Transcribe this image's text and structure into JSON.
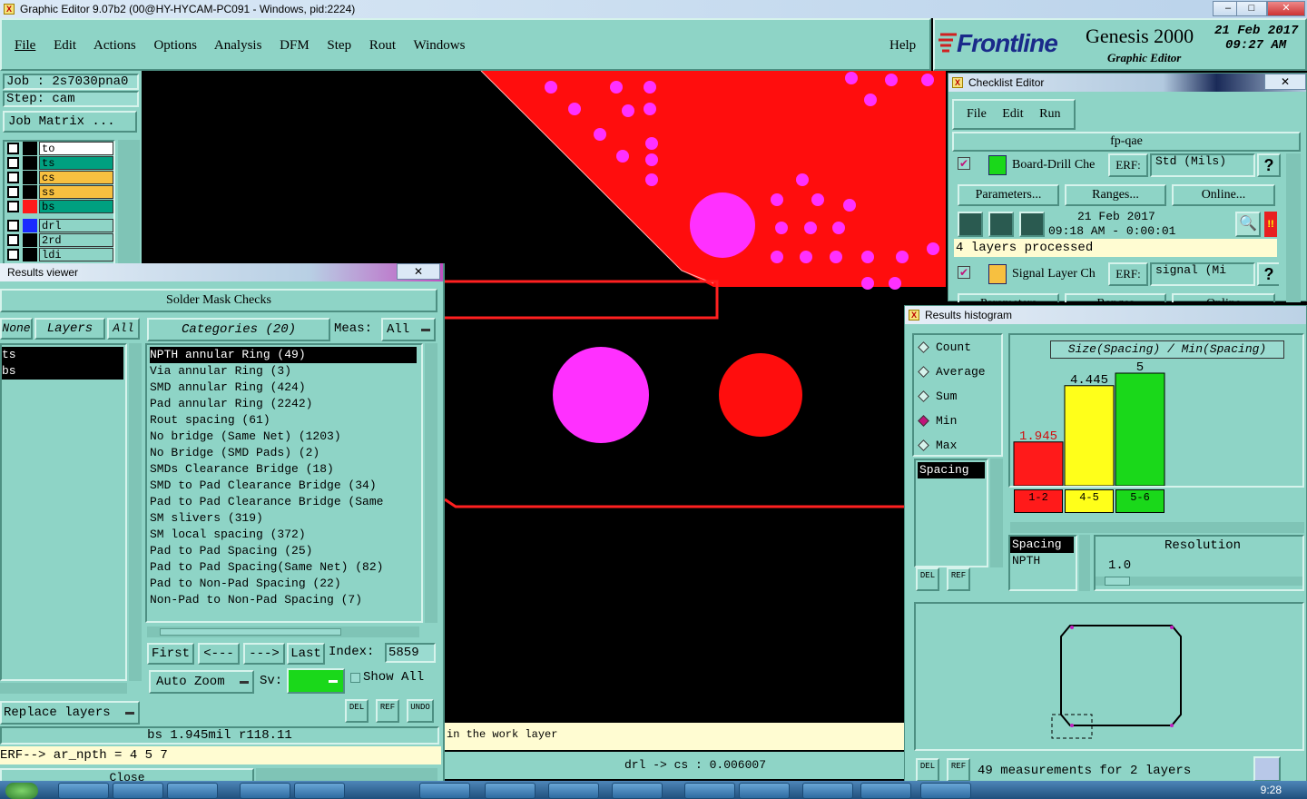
{
  "window": {
    "title": "Graphic Editor 9.07b2 (00@HY-HYCAM-PC091 - Windows, pid:2224)"
  },
  "menu": {
    "items": [
      "File",
      "Edit",
      "Actions",
      "Options",
      "Analysis",
      "DFM",
      "Step",
      "Rout",
      "Windows"
    ],
    "help": "Help"
  },
  "brand": {
    "logo": "Frontline",
    "product": "Genesis 2000",
    "subtitle": "Graphic Editor",
    "date": "21 Feb 2017",
    "time": "09:27 AM"
  },
  "job": {
    "job_line": "Job : 2s7030pna0",
    "step_line": "Step: cam",
    "matrix_button": "Job Matrix ..."
  },
  "layers": [
    {
      "name": "to",
      "color": "#ffffff"
    },
    {
      "name": "ts",
      "color": "#00a080"
    },
    {
      "name": "cs",
      "color": "#f7c040"
    },
    {
      "name": "ss",
      "color": "#f7c040"
    },
    {
      "name": "bs",
      "color": "#00a080"
    },
    {
      "name": "drl",
      "color": "#8ed4c6"
    },
    {
      "name": "2rd",
      "color": "#8ed4c6"
    },
    {
      "name": "ldi",
      "color": "#8ed4c6"
    }
  ],
  "results_viewer": {
    "title": "Results viewer",
    "heading": "Solder Mask Checks",
    "btn_none": "None",
    "btn_layers": "Layers",
    "btn_all": "All",
    "categories_label": "Categories (20)",
    "meas_label": "Meas:",
    "meas_value": "All",
    "layer_items": [
      "ts",
      "bs"
    ],
    "categories": [
      "NPTH annular Ring (49)",
      "Via annular Ring (3)",
      "SMD annular Ring (424)",
      "Pad annular Ring (2242)",
      "Rout spacing (61)",
      "No bridge (Same Net) (1203)",
      "No Bridge (SMD Pads) (2)",
      "SMDs Clearance Bridge (18)",
      "SMD to Pad Clearance Bridge (34)",
      "Pad to Pad Clearance Bridge (Same",
      "SM slivers (319)",
      "SM local spacing (372)",
      "Pad to Pad Spacing (25)",
      "Pad to Pad Spacing(Same Net) (82)",
      "Pad to Non-Pad Spacing (22)",
      "Non-Pad to Non-Pad Spacing (7)"
    ],
    "nav": {
      "first": "First",
      "prev": "<---",
      "next": "--->",
      "last": "Last",
      "index_label": "Index:",
      "index_value": "5859"
    },
    "auto_zoom": "Auto Zoom",
    "sv_label": "Sv:",
    "show_all": "Show All",
    "replace_layers": "Replace layers",
    "del": "DEL",
    "ref": "REF",
    "undo": "UNDO",
    "status": "bs 1.945mil  r118.11",
    "erf_line": "ERF--> ar_npth = 4 5 7",
    "close": "Close"
  },
  "canvas": {
    "message": "in the work layer",
    "coords": "drl -> cs : 0.006007"
  },
  "checklist": {
    "title": "Checklist Editor",
    "menu": [
      "File",
      "Edit",
      "Run"
    ],
    "name": "fp-qae",
    "check1": {
      "label": "Board-Drill Che",
      "erf_label": "ERF:",
      "erf_value": "Std (Mils)",
      "help": "?",
      "parameters": "Parameters...",
      "ranges": "Ranges...",
      "online": "Online...",
      "run_date": "21 Feb 2017",
      "run_time": "09:18 AM - 0:00:01",
      "status": "4 layers processed",
      "alert": "!!"
    },
    "check2": {
      "label": "Signal Layer Ch",
      "erf_label": "ERF:",
      "erf_value": "signal (Mi",
      "help": "?",
      "parameters": "Parameters",
      "ranges": "Ranges",
      "online": "Online"
    }
  },
  "histogram": {
    "title": "Results histogram",
    "modes": [
      {
        "label": "Count",
        "selected": false
      },
      {
        "label": "Average",
        "selected": false
      },
      {
        "label": "Sum",
        "selected": false
      },
      {
        "label": "Min",
        "selected": true
      },
      {
        "label": "Max",
        "selected": false
      }
    ],
    "measure_item": "Spacing",
    "chart_title": "Size(Spacing) / Min(Spacing)",
    "bars": [
      {
        "value_label": "1.945",
        "value": 1.945,
        "range": "1-2",
        "color": "#ff1a1a"
      },
      {
        "value_label": "4.445",
        "value": 4.445,
        "range": "4-5",
        "color": "#ffff1a"
      },
      {
        "value_label": "5",
        "value": 5,
        "range": "5-6",
        "color": "#1ad81a"
      }
    ],
    "list_items": [
      "Spacing",
      "NPTH"
    ],
    "resolution_label": "Resolution",
    "resolution_value": "1.0",
    "measurements": "49 measurements for 2 layers",
    "del": "DEL",
    "ref": "REF"
  },
  "taskbar": {
    "clock": "9:28"
  }
}
